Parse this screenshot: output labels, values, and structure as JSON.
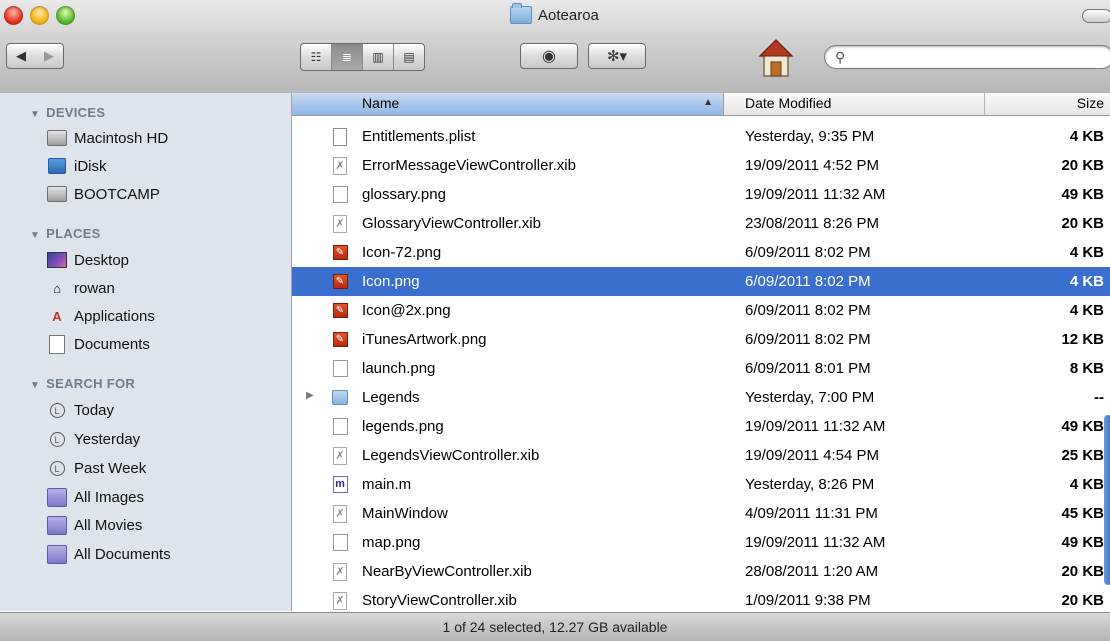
{
  "window": {
    "title": "Aotearoa"
  },
  "toolbar": {
    "back_label": "◀",
    "forward_label": "▶",
    "views": [
      "☷",
      "≣",
      "▥",
      "▤"
    ],
    "quicklook_label": "◉",
    "action_label": "✻▾",
    "search_placeholder": ""
  },
  "sidebar": {
    "devices_label": "DEVICES",
    "devices": [
      "Macintosh HD",
      "iDisk",
      "BOOTCAMP"
    ],
    "places_label": "PLACES",
    "places": [
      "Desktop",
      "rowan",
      "Applications",
      "Documents"
    ],
    "search_label": "SEARCH FOR",
    "searches": [
      "Today",
      "Yesterday",
      "Past Week",
      "All Images",
      "All Movies",
      "All Documents"
    ]
  },
  "list": {
    "columns": {
      "name": "Name",
      "date": "Date Modified",
      "size": "Size"
    },
    "rows": [
      {
        "name": "Entitlements.plist",
        "date": "Yesterday, 9:35 PM",
        "size": "4 KB",
        "icon": "doc"
      },
      {
        "name": "ErrorMessageViewController.xib",
        "date": "19/09/2011 4:52 PM",
        "size": "20 KB",
        "icon": "xib"
      },
      {
        "name": "glossary.png",
        "date": "19/09/2011 11:32 AM",
        "size": "49 KB",
        "icon": "png"
      },
      {
        "name": "GlossaryViewController.xib",
        "date": "23/08/2011 8:26 PM",
        "size": "20 KB",
        "icon": "xib"
      },
      {
        "name": "Icon-72.png",
        "date": "6/09/2011 8:02 PM",
        "size": "4 KB",
        "icon": "red"
      },
      {
        "name": "Icon.png",
        "date": "6/09/2011 8:02 PM",
        "size": "4 KB",
        "icon": "red",
        "selected": true
      },
      {
        "name": "Icon@2x.png",
        "date": "6/09/2011 8:02 PM",
        "size": "4 KB",
        "icon": "red"
      },
      {
        "name": "iTunesArtwork.png",
        "date": "6/09/2011 8:02 PM",
        "size": "12 KB",
        "icon": "red"
      },
      {
        "name": "launch.png",
        "date": "6/09/2011 8:01 PM",
        "size": "8 KB",
        "icon": "png"
      },
      {
        "name": "Legends",
        "date": "Yesterday, 7:00 PM",
        "size": "--",
        "icon": "folder"
      },
      {
        "name": "legends.png",
        "date": "19/09/2011 11:32 AM",
        "size": "49 KB",
        "icon": "png"
      },
      {
        "name": "LegendsViewController.xib",
        "date": "19/09/2011 4:54 PM",
        "size": "25 KB",
        "icon": "xib"
      },
      {
        "name": "main.m",
        "date": "Yesterday, 8:26 PM",
        "size": "4 KB",
        "icon": "m"
      },
      {
        "name": "MainWindow",
        "date": "4/09/2011 11:31 PM",
        "size": "45 KB",
        "icon": "xib"
      },
      {
        "name": "map.png",
        "date": "19/09/2011 11:32 AM",
        "size": "49 KB",
        "icon": "png"
      },
      {
        "name": "NearByViewController.xib",
        "date": "28/08/2011 1:20 AM",
        "size": "20 KB",
        "icon": "xib"
      },
      {
        "name": "StoryViewController.xib",
        "date": "1/09/2011 9:38 PM",
        "size": "20 KB",
        "icon": "xib"
      }
    ]
  },
  "status": {
    "text": "1 of 24 selected, 12.27 GB available"
  },
  "colors": {
    "selection": "#3b6fcf",
    "sidebar_bg": "#dde4eb"
  }
}
